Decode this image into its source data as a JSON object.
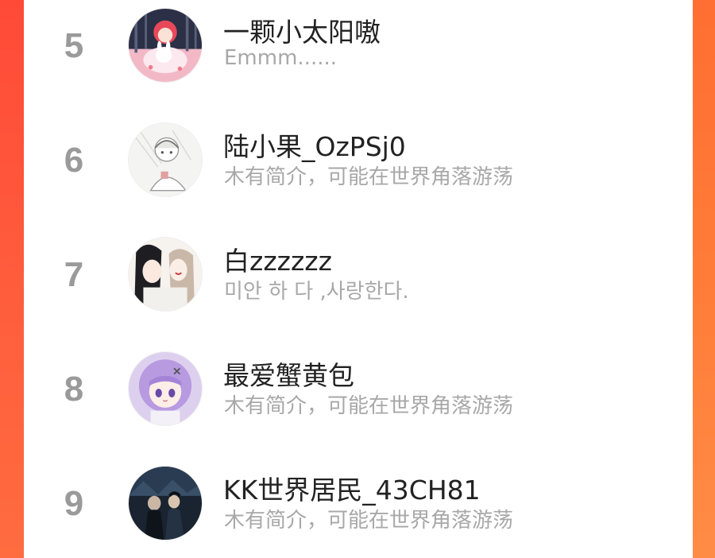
{
  "colors": {
    "background_gradient_top": "#ff5a36",
    "background_gradient_bottom": "#ff8848",
    "rank_color": "#9a9a9a",
    "name_color": "#222222",
    "bio_color": "#a8a8a8",
    "panel_color": "#ffffff"
  },
  "users": [
    {
      "rank": "5",
      "name": "一颗小太阳嗷",
      "bio": "Emmm......",
      "avatar_icon": "anime-girl-red-hair-with-bunny-avatar"
    },
    {
      "rank": "6",
      "name": "陆小果_OzPSj0",
      "bio": "木有简介，可能在世界角落游荡",
      "avatar_icon": "sketch-anime-character-avatar"
    },
    {
      "rank": "7",
      "name": "白zzzzzz",
      "bio": "미안 하 다 ,사랑한다.",
      "avatar_icon": "two-anime-characters-avatar"
    },
    {
      "rank": "8",
      "name": "最爱蟹黄包",
      "bio": "木有简介，可能在世界角落游荡",
      "avatar_icon": "purple-hair-anime-girl-avatar"
    },
    {
      "rank": "9",
      "name": "KK世界居民_43CH81",
      "bio": "木有简介，可能在世界角落游荡",
      "avatar_icon": "dark-night-scene-characters-avatar"
    }
  ]
}
